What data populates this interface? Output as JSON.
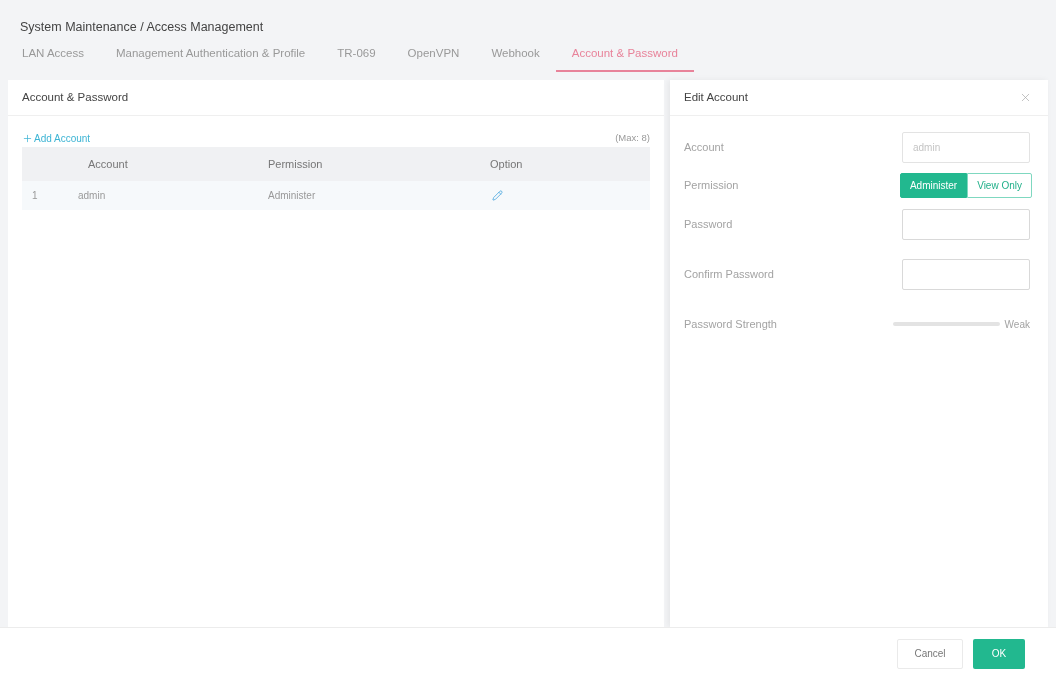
{
  "breadcrumb": "System Maintenance / Access Management",
  "tabs": [
    {
      "label": "LAN Access",
      "selected": false
    },
    {
      "label": "Management Authentication & Profile",
      "selected": false
    },
    {
      "label": "TR-069",
      "selected": false
    },
    {
      "label": "OpenVPN",
      "selected": false
    },
    {
      "label": "Webhook",
      "selected": false
    },
    {
      "label": "Account & Password",
      "selected": true
    }
  ],
  "account_panel": {
    "title": "Account & Password",
    "add_button": "Add Account",
    "max_note": "(Max: 8)",
    "table": {
      "columns": [
        "Account",
        "Permission",
        "Option"
      ],
      "rows": [
        {
          "index": "1",
          "account": "admin",
          "permission": "Administer"
        }
      ]
    }
  },
  "edit_panel": {
    "title": "Edit Account",
    "fields": [
      {
        "kind": "text",
        "label": "Account",
        "value": "admin",
        "disabled": true
      },
      {
        "kind": "segmented",
        "label": "Permission",
        "options": [
          {
            "label": "Administer",
            "selected": true
          },
          {
            "label": "View Only",
            "selected": false
          }
        ]
      },
      {
        "kind": "password",
        "label": "Password"
      },
      {
        "kind": "password",
        "label": "Confirm Password"
      },
      {
        "kind": "meter",
        "label": "Password Strength",
        "reading": "Weak"
      }
    ]
  },
  "footer": {
    "buttons": [
      {
        "label": "Cancel",
        "kind": "secondary"
      },
      {
        "label": "OK",
        "kind": "primary"
      }
    ]
  }
}
